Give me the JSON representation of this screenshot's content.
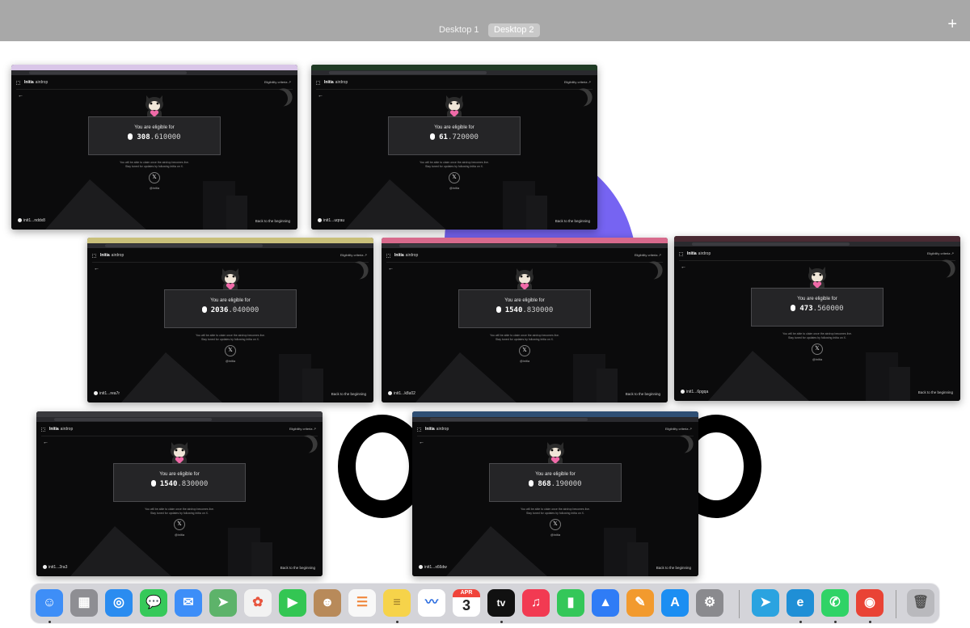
{
  "spaces": {
    "tabs": [
      {
        "label": "Desktop 1",
        "active": false
      },
      {
        "label": "Desktop 2",
        "active": true
      }
    ],
    "add_label": "+"
  },
  "app": {
    "brand": "Initia",
    "brand_sub": "airdrop",
    "criteria_link": "Eligibility criteria ↗",
    "eligible_text": "You are eligible for",
    "note_line1": "You will be able to claim once the airdrop becomes live.",
    "note_line2": "Stay tuned for updates by following Initia on X.",
    "x_handle": "@initia",
    "back_to_beginning": "Back to the beginning",
    "back_arrow": "←",
    "x_icon": "𝕏"
  },
  "windows": [
    {
      "amount_int": "308",
      "amount_dec": ".610000",
      "address": "init1...nddx8",
      "tab_color": "#d9c6e8"
    },
    {
      "amount_int": "61",
      "amount_dec": ".720000",
      "address": "init1...uqrau",
      "tab_color": "#1f3a24"
    },
    {
      "amount_int": "2036",
      "amount_dec": ".040000",
      "address": "init1...rea7r",
      "tab_color": "#c9c07a"
    },
    {
      "amount_int": "1540",
      "amount_dec": ".830000",
      "address": "init1...k8u02",
      "tab_color": "#d86a8c"
    },
    {
      "amount_int": "473",
      "amount_dec": ".560000",
      "address": "init1...6pgqa",
      "tab_color": "#4a2a33"
    },
    {
      "amount_int": "1540",
      "amount_dec": ".830000",
      "address": "init1...2ra3",
      "tab_color": "#3a3a3e"
    },
    {
      "amount_int": "868",
      "amount_dec": ".190000",
      "address": "init1...x66dw",
      "tab_color": "#2f4f74"
    }
  ],
  "dock": {
    "apps": [
      {
        "name": "finder-icon",
        "glyph": "☺",
        "color": "#3e8ef7"
      },
      {
        "name": "launchpad-icon",
        "glyph": "▦",
        "color": "#8e8e93"
      },
      {
        "name": "safari-icon",
        "glyph": "◎",
        "color": "#2a8cf0"
      },
      {
        "name": "messages-icon",
        "glyph": "💬",
        "color": "#36c95a"
      },
      {
        "name": "mail-icon",
        "glyph": "✉",
        "color": "#3d8ef8"
      },
      {
        "name": "maps-icon",
        "glyph": "➤",
        "color": "#5db36a"
      },
      {
        "name": "photos-icon",
        "glyph": "✿",
        "color": "#f2f2f2"
      },
      {
        "name": "facetime-icon",
        "glyph": "▶",
        "color": "#33c653"
      },
      {
        "name": "contacts-icon",
        "glyph": "☻",
        "color": "#b88a5a"
      },
      {
        "name": "reminders-icon",
        "glyph": "☰",
        "color": "#f8f8f8"
      },
      {
        "name": "notes-icon",
        "glyph": "≡",
        "color": "#f6d34a"
      },
      {
        "name": "freeform-icon",
        "glyph": "〰",
        "color": "#ffffff"
      },
      {
        "name": "calendar-icon",
        "glyph": "3",
        "color": "#ffffff"
      },
      {
        "name": "apple-tv-icon",
        "glyph": "tv",
        "color": "#111111"
      },
      {
        "name": "music-icon",
        "glyph": "♫",
        "color": "#f23a52"
      },
      {
        "name": "numbers-icon",
        "glyph": "▮",
        "color": "#34c759"
      },
      {
        "name": "keynote-icon",
        "glyph": "▲",
        "color": "#2f7cf6"
      },
      {
        "name": "pages-icon",
        "glyph": "✎",
        "color": "#f29a2e"
      },
      {
        "name": "app-store-icon",
        "glyph": "A",
        "color": "#1b8ef2"
      },
      {
        "name": "system-settings-icon",
        "glyph": "⚙",
        "color": "#8a8a8e"
      },
      {
        "name": "telegram-icon",
        "glyph": "➤",
        "color": "#2aa3e0"
      },
      {
        "name": "edge-icon",
        "glyph": "e",
        "color": "#1f8fd6"
      },
      {
        "name": "whatsapp-icon",
        "glyph": "✆",
        "color": "#2fd366"
      },
      {
        "name": "chrome-icon",
        "glyph": "◉",
        "color": "#e94335"
      },
      {
        "name": "trash-icon",
        "glyph": "🗑",
        "color": "#b9b9bd"
      }
    ],
    "calendar_month": "APR",
    "calendar_day": "3"
  }
}
